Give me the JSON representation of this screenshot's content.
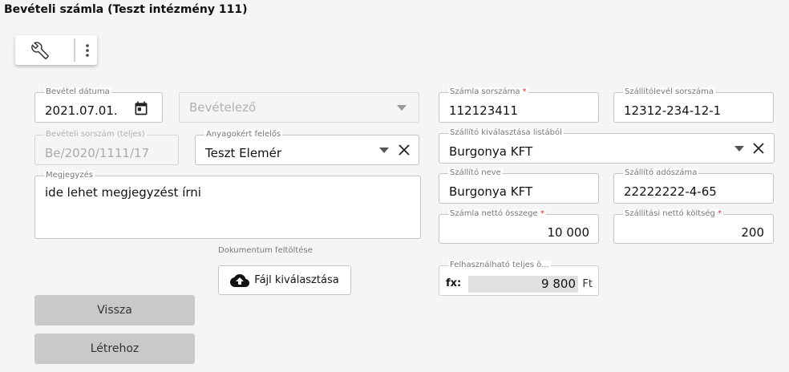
{
  "page": {
    "title": "Bevételi számla (Teszt intézmény 111)"
  },
  "toolbar": {
    "icons": [
      "wrench-icon",
      "more-vert-icon"
    ]
  },
  "fields": {
    "bevetel_datuma": {
      "label": "Bevétel dátuma",
      "value": "2021.07.01."
    },
    "bevetelezo": {
      "placeholder": "Bevételező"
    },
    "bevételi_sorszam": {
      "label": "Bevételi sorszám (teljes)",
      "value": "Be/2020/1111/17"
    },
    "anyagokert_felelos": {
      "label": "Anyagokért felelős",
      "value": "Teszt Elemér"
    },
    "megjegyzes": {
      "label": "Megjegyzés",
      "value": "ide lehet megjegyzést írni"
    },
    "szamla_sorszama": {
      "label": "Számla sorszáma",
      "required": "*",
      "value": "112123411"
    },
    "szallitolevel_sorszama": {
      "label": "Szállítólevél sorszáma",
      "value": "12312-234-12-1"
    },
    "szallito_listabol": {
      "label": "Szállító kiválasztása listából",
      "value": "Burgonya KFT"
    },
    "szallito_neve": {
      "label": "Szállító neve",
      "value": "Burgonya KFT"
    },
    "szallito_adoszama": {
      "label": "Szállító adószáma",
      "value": "22222222-4-65"
    },
    "szamla_netto": {
      "label": "Számla nettó összege",
      "required": "*",
      "value": "10 000"
    },
    "szallitasi_netto": {
      "label": "Szállítási nettó költség",
      "required": "*",
      "value": "200"
    },
    "felhasznalhato": {
      "label": "Felhasználható teljes ö...",
      "prefix": "fx:",
      "value": "9 800",
      "unit": "Ft"
    }
  },
  "upload": {
    "section_label": "Dokumentum feltöltése",
    "button_label": "Fájl kiválasztása"
  },
  "actions": {
    "back_label": "Vissza",
    "create_label": "Létrehoz"
  }
}
